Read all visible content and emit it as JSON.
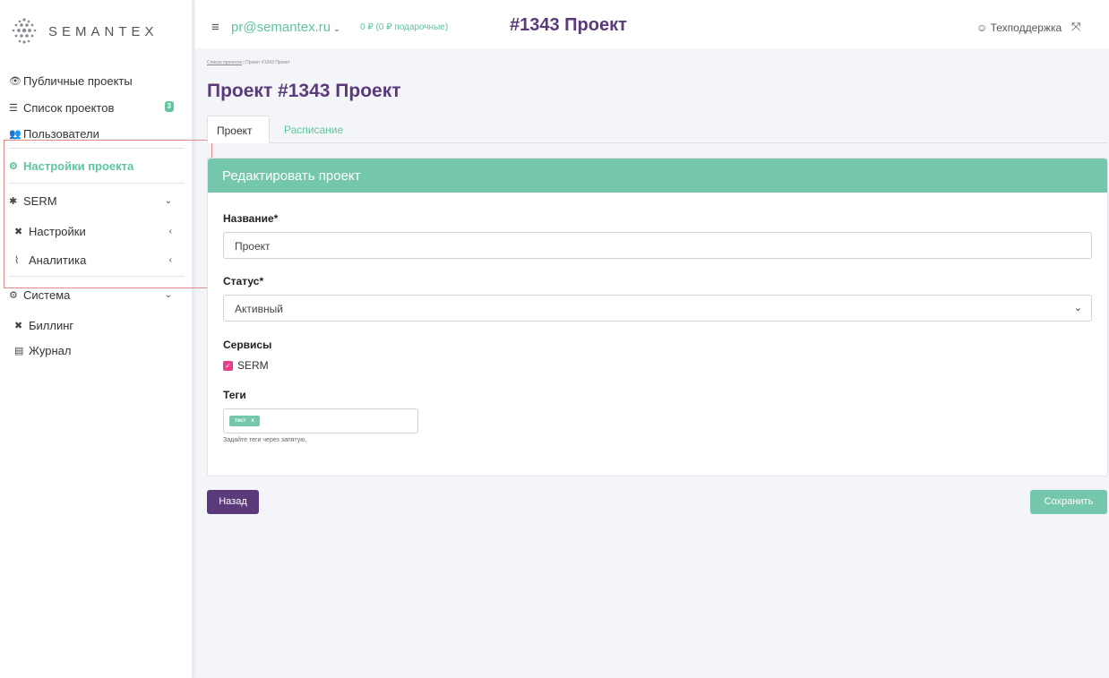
{
  "brand": {
    "name": "SEMANTEX",
    "logo_icon": "semantex-logo-icon"
  },
  "sidebar": {
    "items": [
      {
        "label": "Публичные проекты",
        "icon": "eye-icon"
      },
      {
        "label": "Список проектов",
        "icon": "list-icon",
        "badge": "3"
      },
      {
        "label": "Пользователи",
        "icon": "users-icon"
      },
      {
        "label": "Настройки проекта",
        "icon": "cogs-icon"
      },
      {
        "label": "SERM",
        "icon": "spider-icon"
      },
      {
        "label": "Настройки",
        "icon": "tools-icon"
      },
      {
        "label": "Аналитика",
        "icon": "chart-icon"
      },
      {
        "label": "Система",
        "icon": "cogs-icon"
      },
      {
        "label": "Биллинг",
        "icon": "tools-icon"
      },
      {
        "label": "Журнал",
        "icon": "journal-icon"
      }
    ]
  },
  "header": {
    "email": "pr@semantex.ru",
    "balance": "0 ₽ (0 ₽ подарочные)",
    "title": "#1343 Проект",
    "support": "Техподдержка"
  },
  "breadcrumb": {
    "link": "Список проектов",
    "separator": "|",
    "current": "Проект #1343 Проект"
  },
  "page": {
    "title": "Проект #1343 Проект",
    "tabs": [
      {
        "label": "Проект",
        "active": true
      },
      {
        "label": "Расписание",
        "active": false
      }
    ]
  },
  "form": {
    "header": "Редактировать проект",
    "name_label": "Название*",
    "name_value": "Проект",
    "status_label": "Статус*",
    "status_value": "Активный",
    "services_label": "Сервисы",
    "service_serm": "SERM",
    "service_serm_checked": true,
    "tags_label": "Теги",
    "tags": [
      {
        "label": "тест",
        "remove": "x"
      }
    ],
    "tags_hint": "Задайте теги через запятую."
  },
  "actions": {
    "back": "Назад",
    "save": "Сохранить"
  },
  "colors": {
    "accent_green": "#74c7ac",
    "brand_purple": "#5a3a7a",
    "checkbox_pink": "#e83e8c",
    "highlight_red": "#e48a8a"
  }
}
